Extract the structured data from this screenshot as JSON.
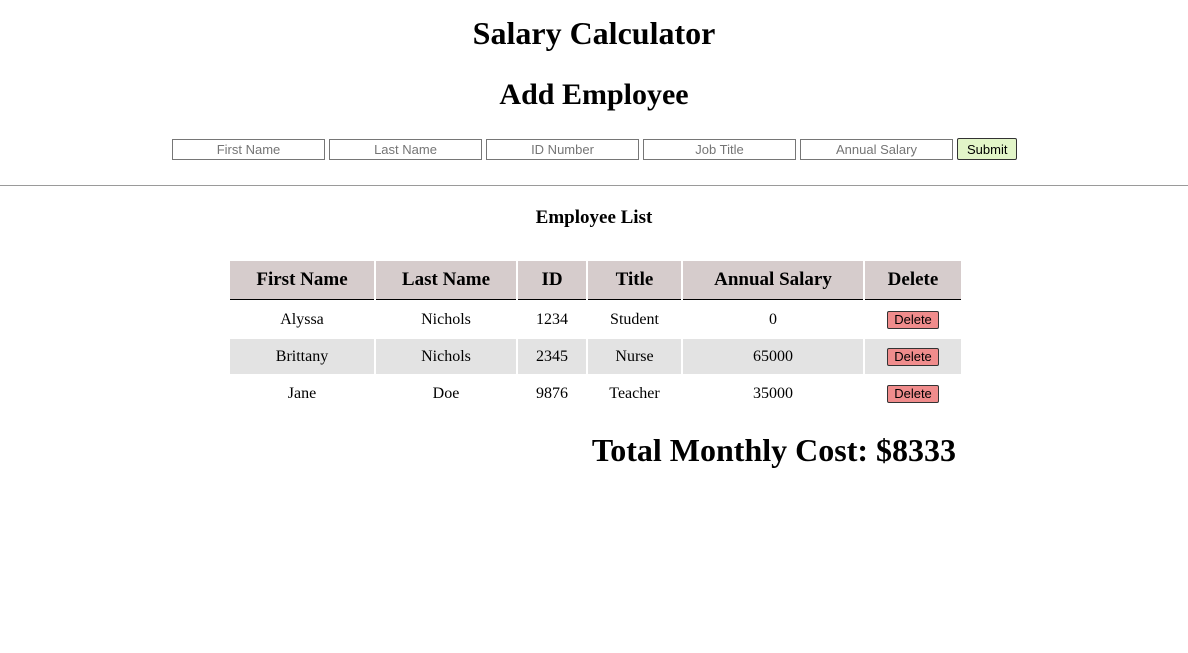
{
  "header": {
    "title": "Salary Calculator",
    "form_title": "Add Employee"
  },
  "form": {
    "first_name_placeholder": "First Name",
    "last_name_placeholder": "Last Name",
    "id_placeholder": "ID Number",
    "job_title_placeholder": "Job Title",
    "salary_placeholder": "Annual Salary",
    "submit_label": "Submit"
  },
  "list": {
    "title": "Employee List",
    "columns": [
      "First Name",
      "Last Name",
      "ID",
      "Title",
      "Annual Salary",
      "Delete"
    ],
    "delete_label": "Delete",
    "rows": [
      {
        "first": "Alyssa",
        "last": "Nichols",
        "id": "1234",
        "title": "Student",
        "salary": "0"
      },
      {
        "first": "Brittany",
        "last": "Nichols",
        "id": "2345",
        "title": "Nurse",
        "salary": "65000"
      },
      {
        "first": "Jane",
        "last": "Doe",
        "id": "9876",
        "title": "Teacher",
        "salary": "35000"
      }
    ]
  },
  "total": {
    "label": "Total Monthly Cost: $8333"
  },
  "colors": {
    "header_bg": "#d6cccc",
    "alt_row_bg": "#e3e3e3",
    "submit_bg": "#e2f5c8",
    "delete_bg": "#f08c8c"
  }
}
